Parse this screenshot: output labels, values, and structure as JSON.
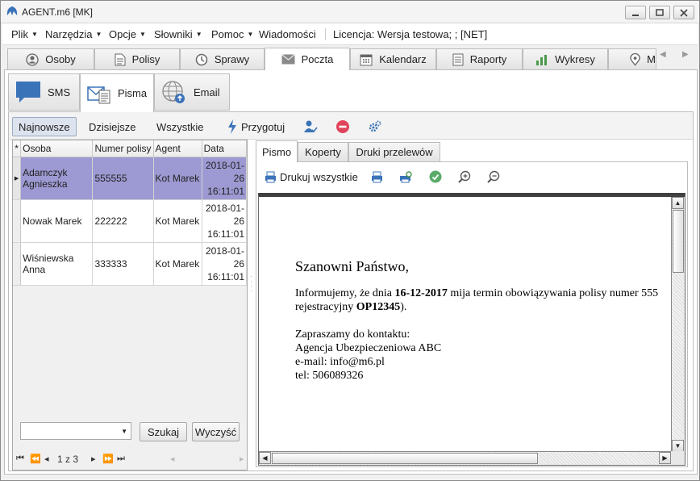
{
  "window": {
    "title": "AGENT.m6 [MK]"
  },
  "menu": {
    "items": [
      "Plik",
      "Narzędzia",
      "Opcje",
      "Słowniki",
      "Pomoc"
    ],
    "messages": "Wiadomości",
    "license": "Licencja: Wersja testowa; ; [NET]"
  },
  "tabs": [
    {
      "label": "Osoby",
      "icon": "person-icon"
    },
    {
      "label": "Polisy",
      "icon": "document-icon"
    },
    {
      "label": "Sprawy",
      "icon": "clock-icon"
    },
    {
      "label": "Poczta",
      "icon": "envelope-icon",
      "active": true
    },
    {
      "label": "Kalendarz",
      "icon": "calendar-icon"
    },
    {
      "label": "Raporty",
      "icon": "report-icon"
    },
    {
      "label": "Wykresy",
      "icon": "bar-chart-icon"
    },
    {
      "label": "M",
      "icon": "map-pin-icon"
    }
  ],
  "subtabs": [
    {
      "label": "SMS",
      "icon": "sms-icon"
    },
    {
      "label": "Pisma",
      "icon": "letter-icon",
      "active": true
    },
    {
      "label": "Email",
      "icon": "globe-icon"
    }
  ],
  "toolbar": {
    "newest": "Najnowsze",
    "today": "Dzisiejsze",
    "all": "Wszystkie",
    "prepare": "Przygotuj"
  },
  "grid": {
    "corner": "*",
    "columns": [
      "Osoba",
      "Numer polisy",
      "Agent",
      "Data"
    ],
    "rows": [
      {
        "osoba": "Adamczyk Agnieszka",
        "numer": "555555",
        "agent": "Kot Marek",
        "data": "2018-01-26 16:11:01",
        "selected": true
      },
      {
        "osoba": "Nowak  Marek",
        "numer": "222222",
        "agent": "Kot Marek",
        "data": "2018-01-26 16:11:01"
      },
      {
        "osoba": "Wiśniewska Anna",
        "numer": "333333",
        "agent": "Kot Marek",
        "data": "2018-01-26 16:11:01"
      }
    ]
  },
  "search": {
    "value": "",
    "button": "Szukaj",
    "clear": "Wyczyść"
  },
  "pager": {
    "text": "1 z 3"
  },
  "preview": {
    "tabs": [
      "Pismo",
      "Koperty",
      "Druki przelewów"
    ],
    "print_all": "Drukuj wszystkie",
    "letter": {
      "greeting": "Szanowni Państwo,",
      "line1_a": "Informujemy, że dnia ",
      "line1_date": "16-12-2017",
      "line1_b": " mija termin obowiązywania polisy numer 555",
      "line2_a": "rejestracyjny ",
      "line2_reg": "OP12345",
      "line2_b": ").",
      "contact1": "Zapraszamy do kontaktu:",
      "contact2": "Agencja Ubezpieczeniowa ABC",
      "contact3": "e-mail: info@m6.pl",
      "contact4": "tel: 506089326"
    }
  },
  "colors": {
    "accent": "#3b73b9",
    "selected_row": "#9d99d2"
  }
}
